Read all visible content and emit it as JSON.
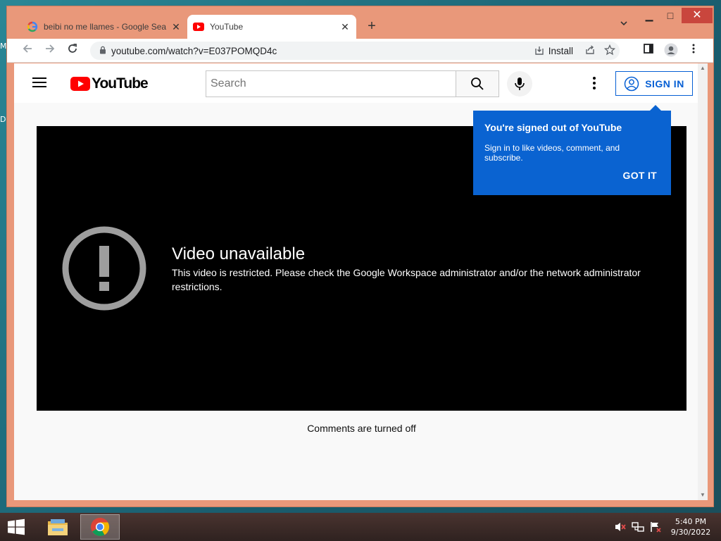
{
  "desktop": {
    "edge_labels": [
      "M",
      "D"
    ]
  },
  "browser": {
    "tabs": [
      {
        "title": "beibi no me llames - Google Sea",
        "favicon": "google-g-icon",
        "active": false
      },
      {
        "title": "YouTube",
        "favicon": "youtube-icon",
        "active": true
      }
    ],
    "new_tab_symbol": "+",
    "window_controls": {
      "minimize": "▁",
      "maximize": "□",
      "close": "✕"
    },
    "address_bar": {
      "url": "youtube.com/watch?v=E037POMQD4c",
      "install_label": "Install"
    }
  },
  "youtube": {
    "logo_text": "YouTube",
    "search": {
      "placeholder": "Search",
      "value": ""
    },
    "sign_in_label": "SIGN IN",
    "tooltip": {
      "title": "You're signed out of YouTube",
      "body": "Sign in to like videos, comment, and subscribe.",
      "button": "GOT IT"
    },
    "player": {
      "error_title": "Video unavailable",
      "error_message": "This video is restricted. Please check the Google Workspace administrator and/or the network administrator restrictions."
    },
    "comments_status": "Comments are turned off"
  },
  "colors": {
    "youtube_red": "#ff0000",
    "link_blue": "#065fd4",
    "tooltip_blue": "#0a63d1",
    "window_frame": "#e9987a"
  },
  "taskbar": {
    "apps": [
      "file-explorer-icon",
      "chrome-icon"
    ],
    "clock": {
      "time": "5:40 PM",
      "date": "9/30/2022"
    }
  }
}
